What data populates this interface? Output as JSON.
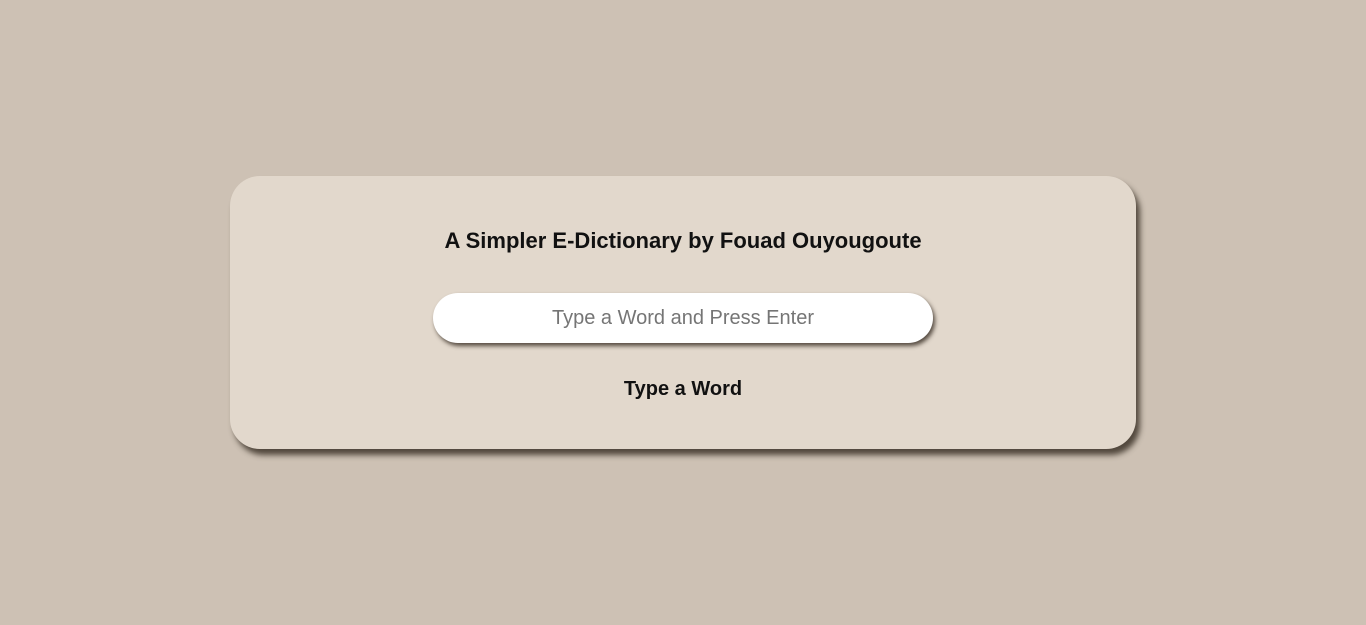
{
  "app": {
    "title": "A Simpler E-Dictionary by Fouad Ouyougoute"
  },
  "search": {
    "value": "",
    "placeholder": "Type a Word and Press Enter"
  },
  "result": {
    "text": "Type a Word"
  },
  "colors": {
    "page_background": "#cdc1b4",
    "card_background": "#e2d8cc",
    "input_background": "#ffffff",
    "text": "#111111"
  }
}
